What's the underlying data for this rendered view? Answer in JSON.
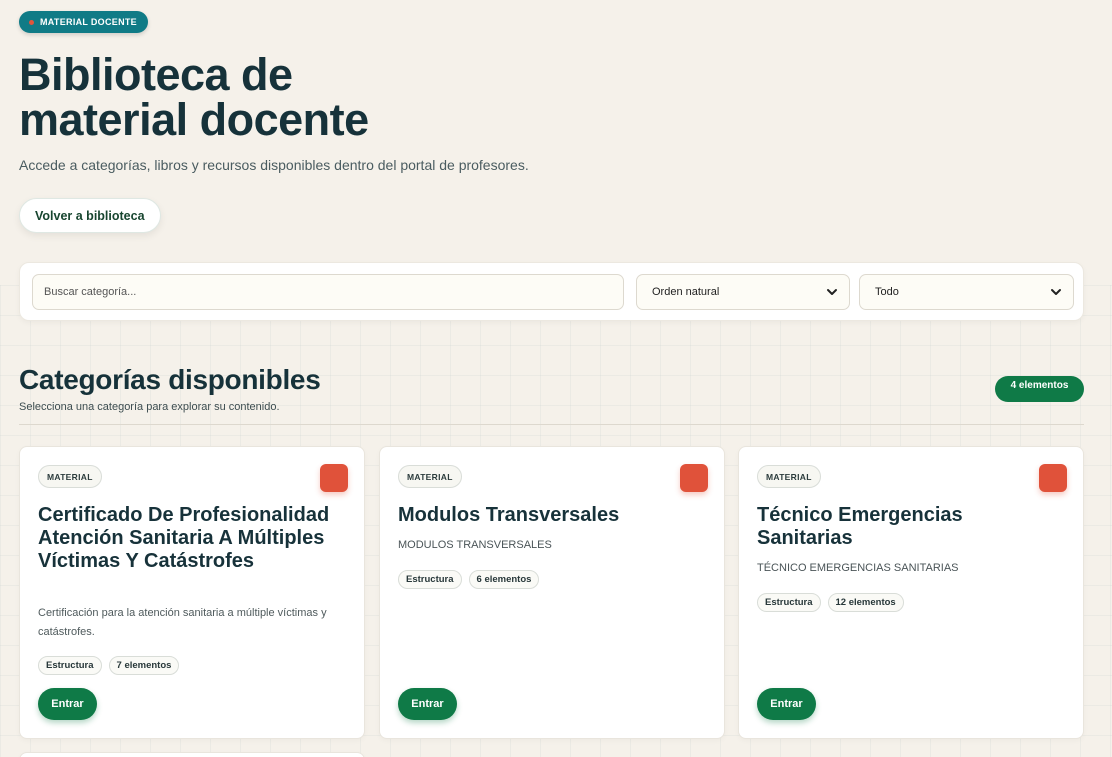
{
  "header": {
    "tag": "MATERIAL DOCENTE",
    "title": "Biblioteca de material docente",
    "subtitle": "Accede a categorías, libros y recursos disponibles dentro del portal de profesores.",
    "back_button": "Volver a biblioteca"
  },
  "filters": {
    "search_placeholder": "Buscar categoría...",
    "order_selected": "Orden natural",
    "scope_selected": "Todo"
  },
  "section": {
    "title": "Categorías disponibles",
    "subtitle": "Selecciona una categoría para explorar su contenido.",
    "count_badge": "4 elementos"
  },
  "colors": {
    "accent_green": "#0f7a47",
    "accent_teal": "#107b86",
    "accent_orange": "#e0523a",
    "background": "#f5f1ea"
  },
  "cards": [
    {
      "tag": "MATERIAL",
      "title": "Certificado De Profesionalidad Atención Sanitaria A Múltiples Víctimas Y Catástrofes",
      "subtitle": "",
      "description": "Certificación para la atención sanitaria a múltiple víctimas y catástrofes.",
      "chip_type": "Estructura",
      "chip_count": "7 elementos",
      "button": "Entrar"
    },
    {
      "tag": "MATERIAL",
      "title": "Modulos Transversales",
      "subtitle": "MODULOS TRANSVERSALES",
      "description": "",
      "chip_type": "Estructura",
      "chip_count": "6 elementos",
      "button": "Entrar"
    },
    {
      "tag": "MATERIAL",
      "title": "Técnico Emergencias Sanitarias",
      "subtitle": "TÉCNICO EMERGENCIAS SANITARIAS",
      "description": "",
      "chip_type": "Estructura",
      "chip_count": "12 elementos",
      "button": "Entrar"
    }
  ]
}
